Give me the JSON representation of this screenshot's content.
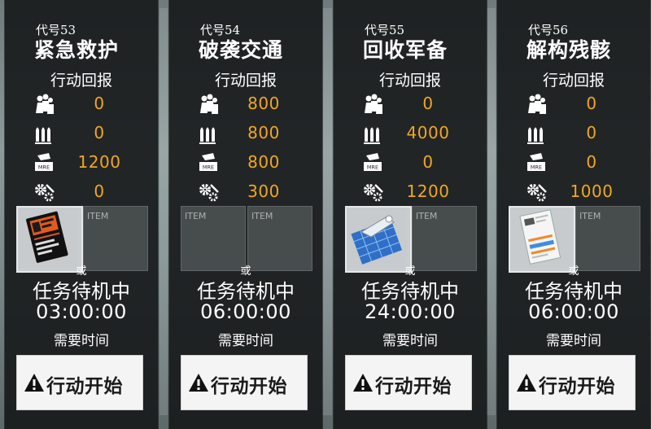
{
  "reward_title": "行动回报",
  "or_text": "或",
  "time_label": "需要时间",
  "start_label": "行动开始",
  "item_placeholder": "ITEM",
  "missions": [
    {
      "code": "代号53",
      "name": "紧急救护",
      "rewards": {
        "manpower": "0",
        "ammo": "0",
        "rations": "1200",
        "parts": "0"
      },
      "status": "任务待机中",
      "time": "03:00:00"
    },
    {
      "code": "代号54",
      "name": "破袭交通",
      "rewards": {
        "manpower": "800",
        "ammo": "800",
        "rations": "800",
        "parts": "300"
      },
      "status": "任务待机中",
      "time": "06:00:00"
    },
    {
      "code": "代号55",
      "name": "回收军备",
      "rewards": {
        "manpower": "0",
        "ammo": "4000",
        "rations": "0",
        "parts": "1200"
      },
      "status": "任务待机中",
      "time": "24:00:00"
    },
    {
      "code": "代号56",
      "name": "解构残骸",
      "rewards": {
        "manpower": "0",
        "ammo": "0",
        "rations": "0",
        "parts": "1000"
      },
      "status": "任务待机中",
      "time": "06:00:00"
    }
  ],
  "colors": {
    "reward_value": "#f2a623",
    "card_bg": "#16181a",
    "button_bg": "#f4f4f4"
  }
}
